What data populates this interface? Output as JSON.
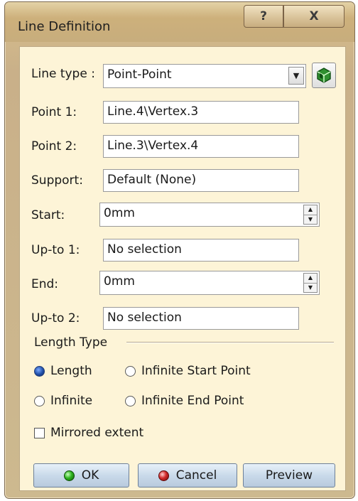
{
  "window": {
    "title": "Line Definition",
    "help_glyph": "?",
    "close_glyph": "X"
  },
  "form": {
    "line_type": {
      "label": "Line type :",
      "value": "Point-Point",
      "dropdown_glyph": "▼"
    },
    "point1": {
      "label": "Point 1:",
      "value": "Line.4\\Vertex.3"
    },
    "point2": {
      "label": "Point 2:",
      "value": "Line.3\\Vertex.4"
    },
    "support": {
      "label": "Support:",
      "value": "Default (None)"
    },
    "start": {
      "label": "Start:",
      "value": "0mm"
    },
    "upto1": {
      "label": "Up-to 1:",
      "value": "No selection"
    },
    "end": {
      "label": "End:",
      "value": "0mm"
    },
    "upto2": {
      "label": "Up-to 2:",
      "value": "No selection"
    }
  },
  "length_type": {
    "title": "Length Type",
    "options": {
      "length": "Length",
      "infinite_start": "Infinite Start Point",
      "infinite": "Infinite",
      "infinite_end": "Infinite End Point"
    },
    "selected": "Length"
  },
  "mirrored_extent": {
    "label": "Mirrored extent",
    "checked": false
  },
  "buttons": {
    "ok": "OK",
    "cancel": "Cancel",
    "preview": "Preview"
  },
  "icons": {
    "cube": "cube-icon",
    "ok_led": "green-led-icon",
    "cancel_led": "red-led-icon"
  },
  "colors": {
    "frame": "#d2b98a",
    "client_bg": "#fdf4d7",
    "button_face": "#c9daea",
    "ok_led": "#2fb51f",
    "cancel_led": "#d22a2a"
  }
}
